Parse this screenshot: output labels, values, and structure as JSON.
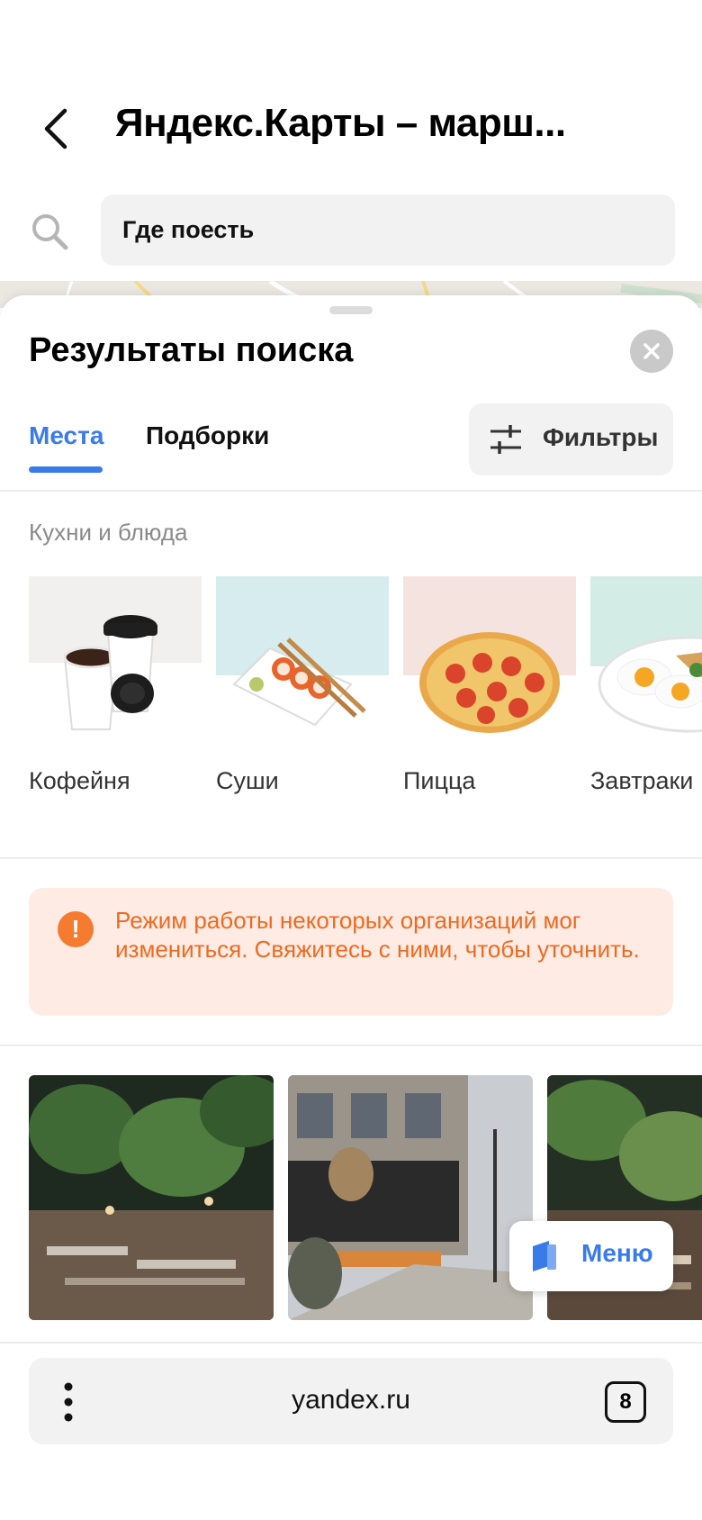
{
  "header": {
    "title": "Яндекс.Карты – марш...",
    "search_value": "Где поесть"
  },
  "results": {
    "title": "Результаты поиска",
    "tabs": [
      {
        "label": "Места",
        "active": true
      },
      {
        "label": "Подборки",
        "active": false
      }
    ],
    "filters_label": "Фильтры",
    "accent_color": "#3a7bea"
  },
  "cuisines": {
    "heading": "Кухни и блюда",
    "items": [
      {
        "label": "Кофейня",
        "icon": "coffee-cups-image"
      },
      {
        "label": "Суши",
        "icon": "sushi-image"
      },
      {
        "label": "Пицца",
        "icon": "pizza-image"
      },
      {
        "label": "Завтраки",
        "icon": "breakfast-image"
      }
    ]
  },
  "notice": {
    "text": "Режим работы некоторых организаций мог измениться. Свяжитесь с ними, чтобы уточнить.",
    "icon": "exclamation-icon",
    "color": "#ee6a20"
  },
  "photos": {
    "menu_label": "Меню"
  },
  "browser": {
    "url": "yandex.ru",
    "tabs_count": "8"
  }
}
